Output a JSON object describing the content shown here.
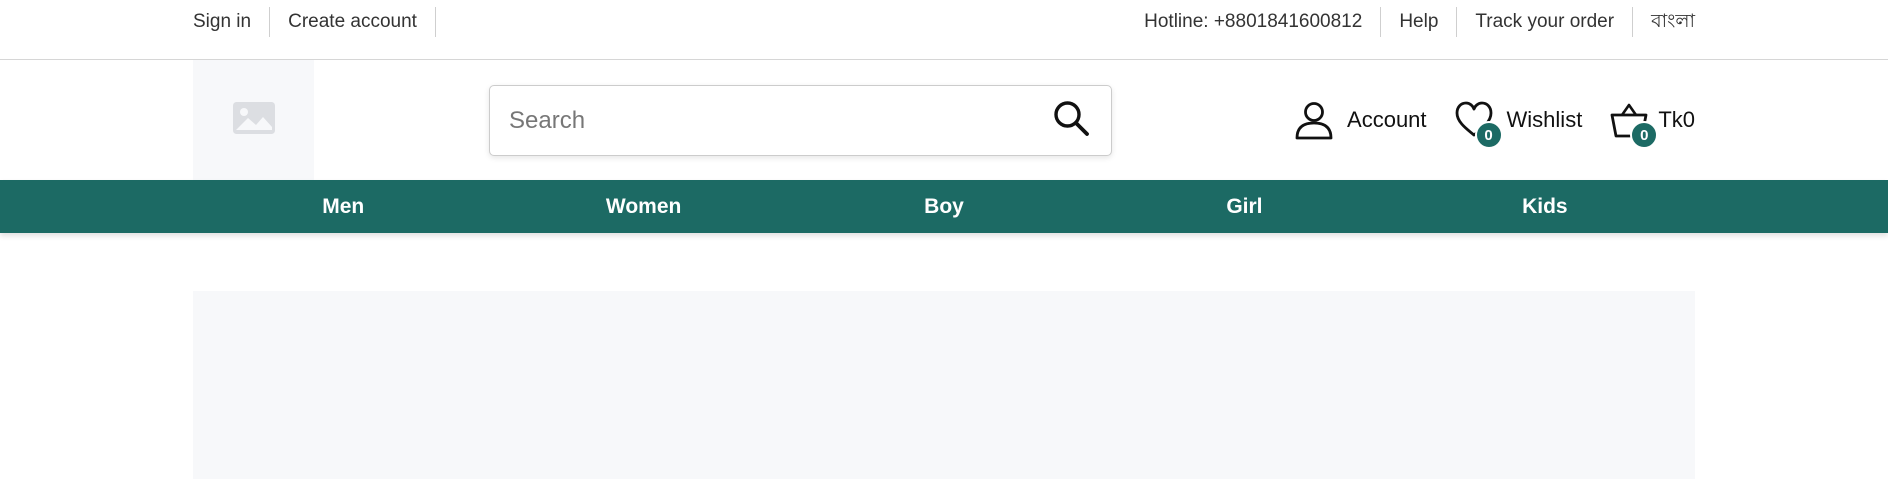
{
  "topbar": {
    "sign_in": "Sign in",
    "create_account": "Create account",
    "hotline": "Hotline: +8801841600812",
    "help": "Help",
    "track_order": "Track your order",
    "language": "বাংলা"
  },
  "header": {
    "search": {
      "placeholder": "Search",
      "value": ""
    },
    "account_label": "Account",
    "wishlist_label": "Wishlist",
    "wishlist_count": "0",
    "cart_total": "Tk0",
    "cart_count": "0"
  },
  "nav": {
    "items": [
      {
        "label": "Men"
      },
      {
        "label": "Women"
      },
      {
        "label": "Boy"
      },
      {
        "label": "Girl"
      },
      {
        "label": "Kids"
      }
    ]
  },
  "icons": {
    "logo": "image-placeholder-icon",
    "search": "search-icon",
    "account": "user-icon",
    "wishlist": "heart-icon",
    "cart": "basket-icon"
  },
  "colors": {
    "brand": "#1c6a64",
    "nav_text": "#ffffff",
    "placeholder_bg": "#f7f8fa"
  }
}
